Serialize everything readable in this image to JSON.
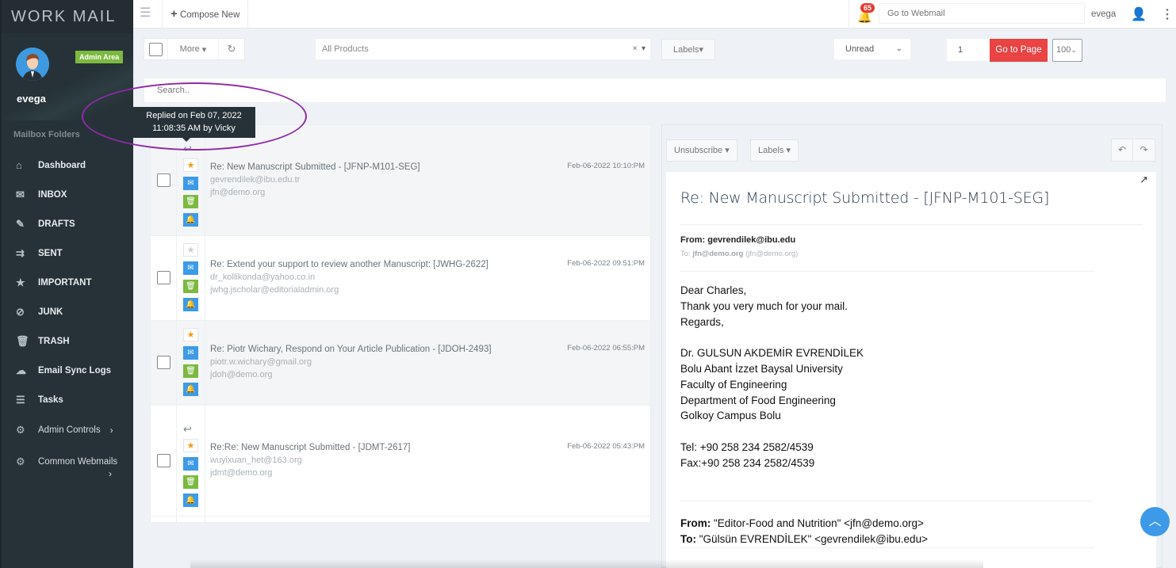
{
  "sidebar": {
    "brand": "WORK MAIL",
    "admin_badge": "Admin Area",
    "username": "evega",
    "folders_title": "Mailbox Folders",
    "items": [
      {
        "label": "Dashboard",
        "icon": "home-icon"
      },
      {
        "label": "INBOX",
        "icon": "inbox-icon"
      },
      {
        "label": "DRAFTS",
        "icon": "edit-icon"
      },
      {
        "label": "SENT",
        "icon": "send-icon"
      },
      {
        "label": "IMPORTANT",
        "icon": "star-icon"
      },
      {
        "label": "JUNK",
        "icon": "ban-icon"
      },
      {
        "label": "TRASH",
        "icon": "trash-icon"
      },
      {
        "label": "Email Sync Logs",
        "icon": "cloud-download-icon"
      },
      {
        "label": "Tasks",
        "icon": "tasks-icon"
      },
      {
        "label": "Admin Controls",
        "icon": "gear-icon"
      },
      {
        "label": "Common Webmails",
        "icon": "gear-icon"
      }
    ]
  },
  "topbar": {
    "compose_label": "Compose New",
    "notification_count": "65",
    "webmail_placeholder": "Go to Webmail",
    "user": "evega"
  },
  "toolbar": {
    "more_label": "More",
    "products_value": "All Products",
    "products_clear": "×",
    "labels_label": "Labels",
    "filter_value": "Unread",
    "page_value": "1",
    "goto_label": "Go to Page",
    "per_page_value": "100"
  },
  "search": {
    "placeholder": "Search.."
  },
  "tooltip": {
    "line1": "Replied on Feb 07, 2022",
    "line2": "11:08:35 AM by Vicky"
  },
  "emails": [
    {
      "subject": "Re: New Manuscript Submitted - [JFNP-M101-SEG]",
      "from": "gevrendilek@ibu.edu.tr",
      "to": "jfn@demo.org",
      "date": "Feb-06-2022 10:10:PM",
      "starred": true,
      "replied": true
    },
    {
      "subject": "Re: Extend your support to review another Manuscript: [JWHG-2622]",
      "from": "dr_kollikonda@yahoo.co.in",
      "to": "jwhg.jscholar@editorialadmin.org",
      "date": "Feb-06-2022 09:51:PM",
      "starred": false,
      "replied": false
    },
    {
      "subject": "Re: Piotr Wichary, Respond on Your Article Publication - [JDOH-2493]",
      "from": "piotr.w.wichary@gmail.org",
      "to": "jdoh@demo.org",
      "date": "Feb-06-2022 06:55:PM",
      "starred": true,
      "replied": false
    },
    {
      "subject": "Re:Re: New Manuscript Submitted - [JDMT-2617]",
      "from": "wuyixuan_het@163.org",
      "to": "jdmt@demo.org",
      "date": "Feb-06-2022 05:43:PM",
      "starred": true,
      "replied": true
    }
  ],
  "preview": {
    "unsubscribe_label": "Unsubscribe",
    "labels_label": "Labels",
    "subject": "Re: New Manuscript Submitted - [JFNP-M101-SEG]",
    "from": "From: gevrendilek@ibu.edu",
    "to_prefix": "To:",
    "to_email": "jfn@demo.org",
    "to_paren": "(jfn@demo.org)",
    "body": "Dear Charles,\nThank you very much for your mail.\nRegards,\n\nDr. GULSUN AKDEMİR EVRENDİLEK\nBolu Abant İzzet Baysal University\nFaculty of Engineering\nDepartment of Food Engineering\nGolkoy Campus Bolu\n\nTel: +90 258 234 2582/4539\nFax:+90 258 234 2582/4539",
    "quote_from_label": "From:",
    "quote_from": "\"Editor-Food and Nutrition\" <jfn@demo.org>",
    "quote_to_label": "To:",
    "quote_to": "\"Gülsün EVRENDİLEK\" <gevrendilek@ibu.edu>"
  },
  "colors": {
    "sidebar": "#263238",
    "accent_blue": "#3d9ae8",
    "accent_green": "#7cb940",
    "danger": "#e94343",
    "annotation": "#8e2aa8"
  }
}
